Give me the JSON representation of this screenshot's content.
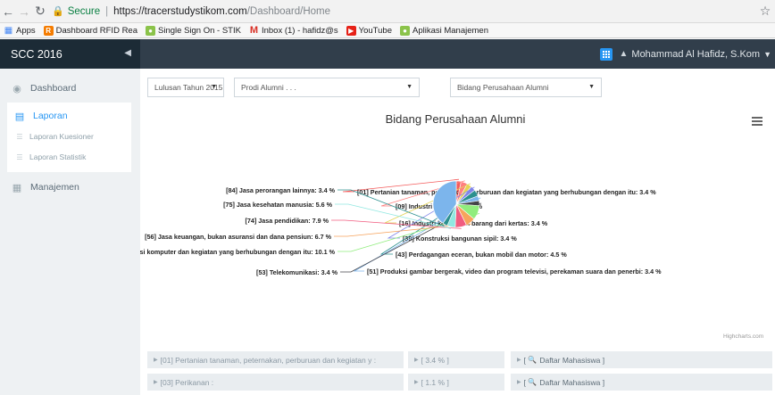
{
  "browser": {
    "secure_label": "Secure",
    "url_host": "https://tracerstudystikom.com",
    "url_path": "/Dashboard/Home",
    "bookmarks": [
      {
        "label": "Apps",
        "icon": "apps-icon"
      },
      {
        "label": "Dashboard RFID Rea",
        "icon": "rfid-icon"
      },
      {
        "label": "Single Sign On - STIK",
        "icon": "sso-icon"
      },
      {
        "label": "Inbox (1) - hafidz@s",
        "icon": "gmail-icon"
      },
      {
        "label": "YouTube",
        "icon": "youtube-icon"
      },
      {
        "label": "Aplikasi Manajemen",
        "icon": "app-icon"
      }
    ]
  },
  "header": {
    "brand": "SCC 2016",
    "user_name": "Mohammad Al Hafidz, S.Kom"
  },
  "sidebar": {
    "dashboard": "Dashboard",
    "laporan": "Laporan",
    "laporan_kuesioner": "Laporan Kuesioner",
    "laporan_statistik": "Laporan Statistik",
    "manajemen": "Manajemen"
  },
  "filters": {
    "lulusan": "Lulusan Tahun 2015",
    "prodi": "Prodi Alumni . . .",
    "bidang": "Bidang Perusahaan Alumni"
  },
  "chart_data": {
    "type": "pie",
    "title": "Bidang Perusahaan Alumni",
    "credits": "Highcharts.com",
    "slices": [
      {
        "label": "[01] Pertanian tanaman, peternakan, perburuan dan kegiatan yang berhubungan dengan itu",
        "value": 3.4,
        "color": "#f45b5b"
      },
      {
        "label": "[09] Industri makanan",
        "value": 4.5,
        "color": "#ff7f7f"
      },
      {
        "label": "[16] Industri kertas dan barang dari kertas",
        "value": 3.4,
        "color": "#e4d354"
      },
      {
        "label": "[39] Konstruksi bangunan sipil",
        "value": 3.4,
        "color": "#8085e9"
      },
      {
        "label": "[43] Perdagangan eceran, bukan mobil dan motor",
        "value": 4.5,
        "color": "#2b908f"
      },
      {
        "label": "[51] Produksi gambar bergerak, video dan program televisi, perekaman suara dan penerbi",
        "value": 3.4,
        "color": "#7cb5ec"
      },
      {
        "label": "[53] Telekomunikasi",
        "value": 3.4,
        "color": "#434348"
      },
      {
        "label": "pemrograman, konsultasi komputer dan kegiatan yang berhubungan dengan itu",
        "value": 10.1,
        "color": "#90ed7d"
      },
      {
        "label": "[56] Jasa keuangan, bukan asuransi dan dana pensiun",
        "value": 6.7,
        "color": "#f7a35c"
      },
      {
        "label": "[74] Jasa pendidikan",
        "value": 7.9,
        "color": "#f15c80"
      },
      {
        "label": "[75] Jasa kesehatan manusia",
        "value": 5.6,
        "color": "#91e8e1"
      },
      {
        "label": "[84] Jasa perorangan lainnya",
        "value": 3.4,
        "color": "#2b908f"
      },
      {
        "label": "",
        "value": 40.3,
        "color": "#7cb5ec"
      }
    ]
  },
  "table": {
    "rows": [
      {
        "label": "[01] Pertanian tanaman, peternakan, perburuan dan kegiatan y :",
        "value": "[ 3.4 % ]",
        "action": "Daftar Mahasiswa ]"
      },
      {
        "label": "[03] Perikanan :",
        "value": "[ 1.1 % ]",
        "action": "Daftar Mahasiswa ]"
      }
    ]
  }
}
